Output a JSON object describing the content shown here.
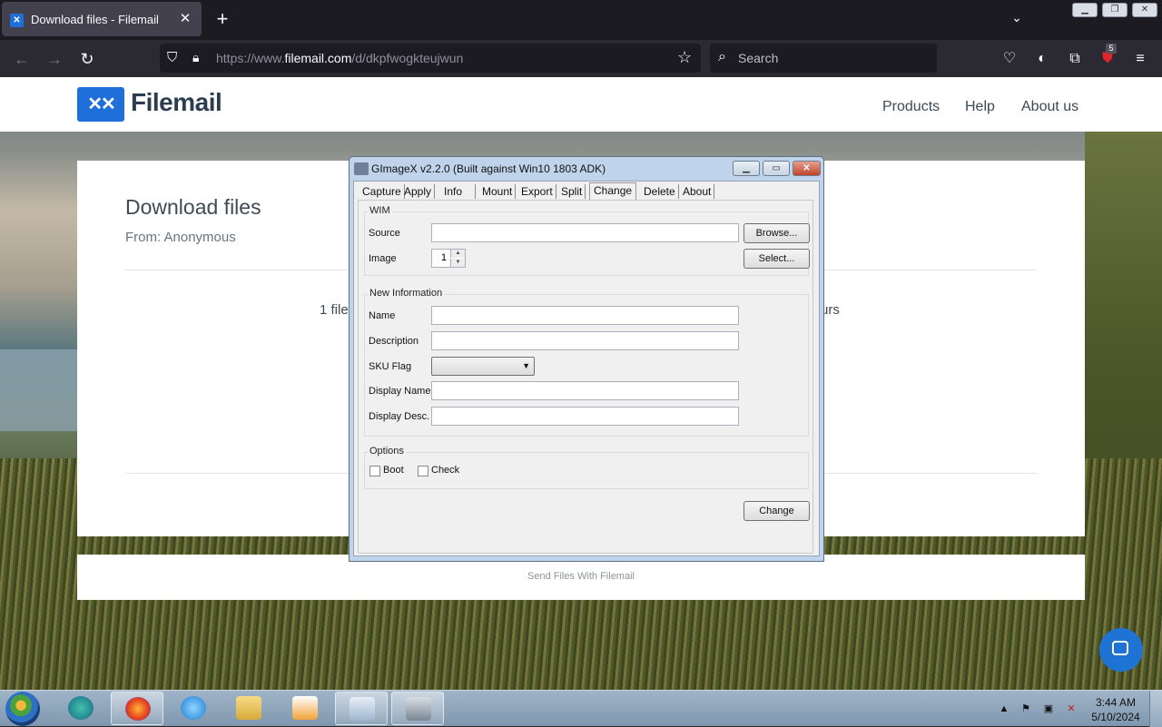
{
  "browser": {
    "tab_title": "Download files - Filemail",
    "url_prefix": "https://www.",
    "url_domain": "filemail.com",
    "url_path": "/d/dkpfwogkteujwun",
    "search_placeholder": "Search",
    "extension_badge": "5"
  },
  "site": {
    "logo": "Filemail",
    "nav": [
      "Products",
      "Help",
      "About us"
    ],
    "title": "Download files",
    "from": "From: Anonymous",
    "files_text": "1 file",
    "hours_text": "urs",
    "footer": "Send Files With Filemail"
  },
  "dialog": {
    "title": "GImageX v2.2.0 (Built against Win10 1803 ADK)",
    "tabs": [
      "Capture",
      "Apply",
      "Info",
      "Mount",
      "Export",
      "Split",
      "Change",
      "Delete",
      "About"
    ],
    "active_tab": "Change",
    "wim_group": "WIM",
    "source_label": "Source",
    "source_value": "",
    "browse_button": "Browse...",
    "image_label": "Image",
    "image_value": "1",
    "select_button": "Select...",
    "new_info_group": "New Information",
    "name_label": "Name",
    "description_label": "Description",
    "sku_flag_label": "SKU Flag",
    "sku_flag_value": "",
    "display_name_label": "Display Name",
    "display_desc_label": "Display Desc.",
    "options_group": "Options",
    "boot_label": "Boot",
    "check_label": "Check",
    "change_button": "Change"
  },
  "taskbar": {
    "time": "3:44 AM",
    "date": "5/10/2024"
  }
}
